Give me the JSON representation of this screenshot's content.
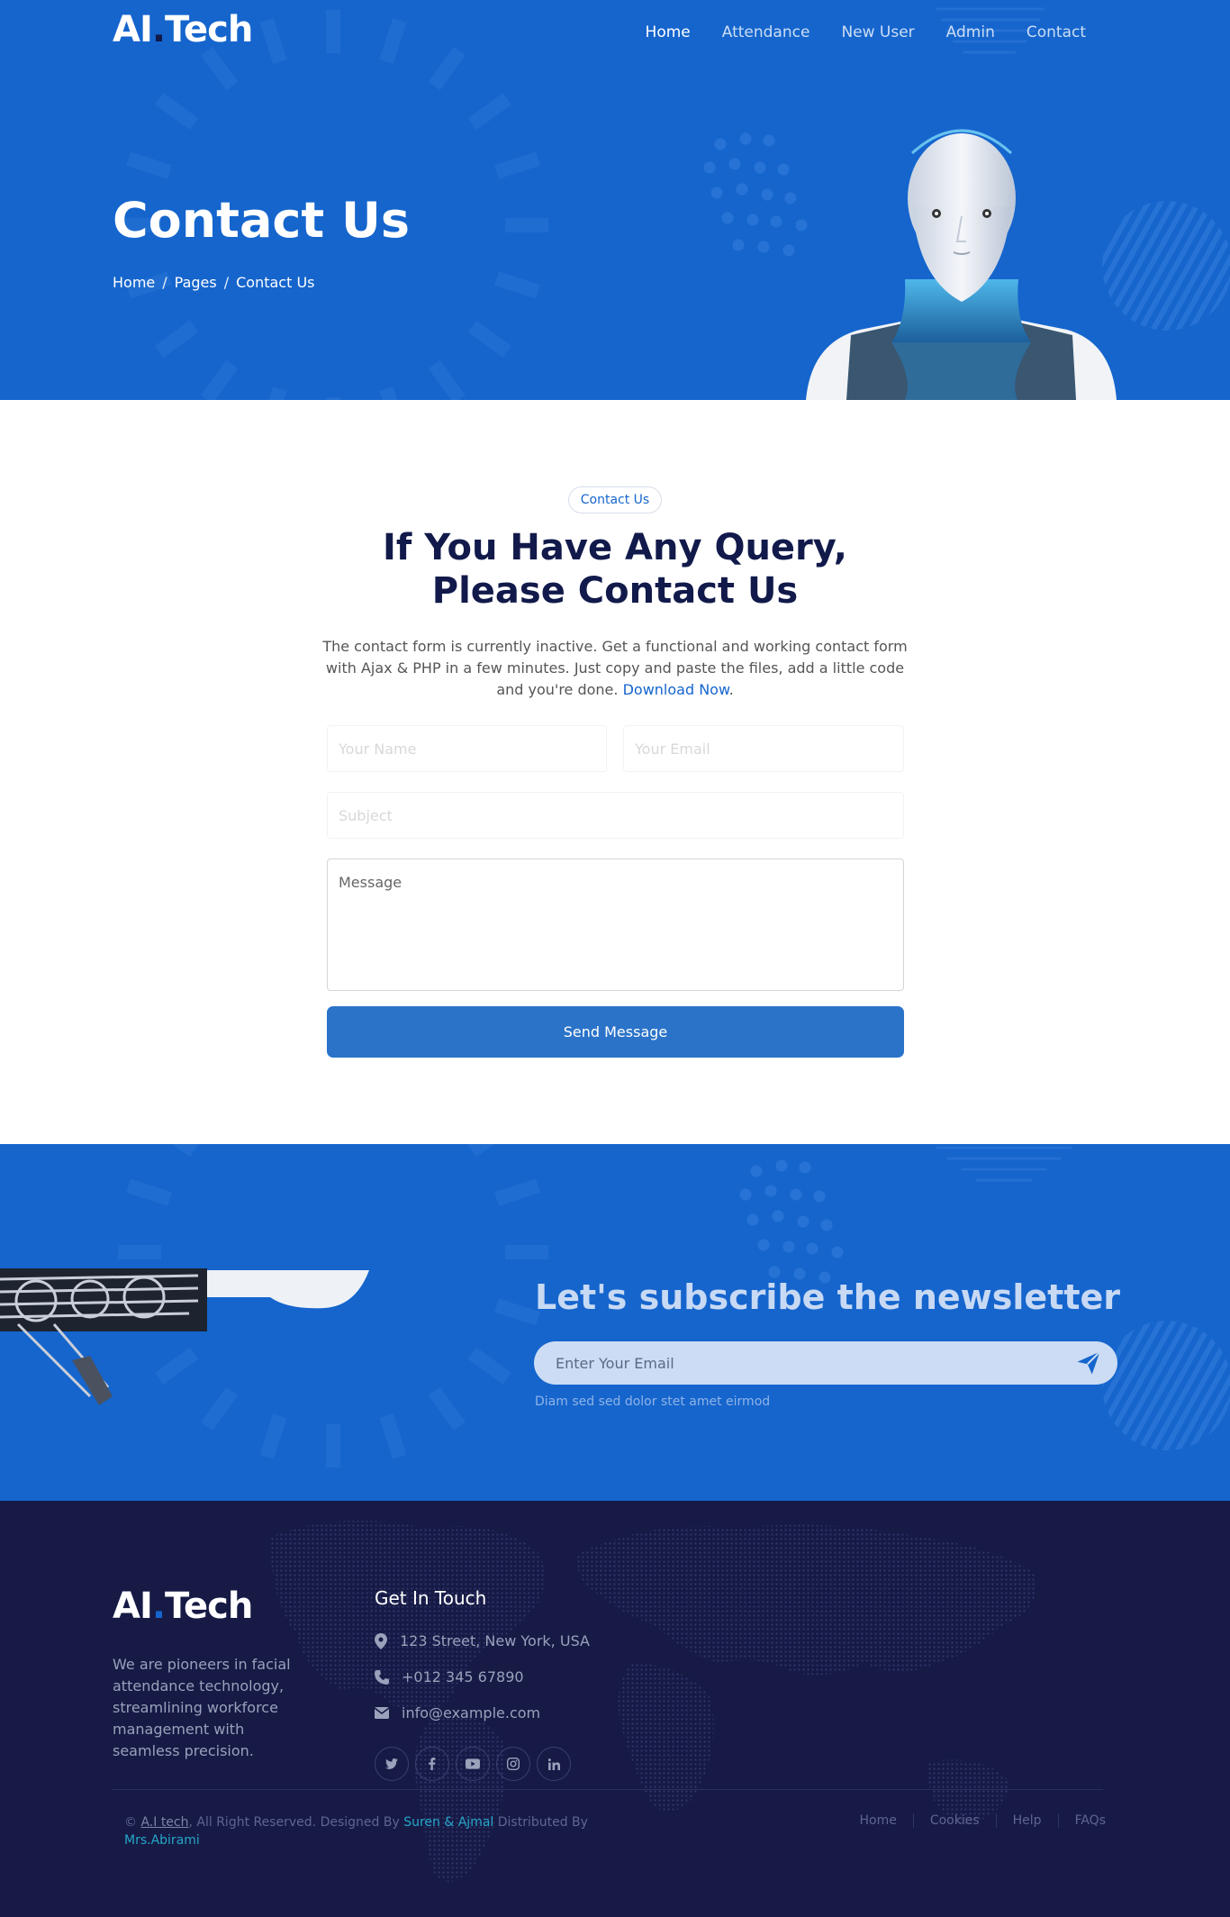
{
  "header": {
    "logo": {
      "part1": "AI",
      "dot": ".",
      "part2": "Tech"
    },
    "nav": [
      {
        "label": "Home",
        "active": true
      },
      {
        "label": "Attendance"
      },
      {
        "label": "New User"
      },
      {
        "label": "Admin"
      },
      {
        "label": "Contact"
      }
    ]
  },
  "hero": {
    "title": "Contact Us",
    "breadcrumb": [
      "Home",
      "Pages",
      "Contact Us"
    ],
    "separator": "/"
  },
  "contact": {
    "pill": "Contact Us",
    "title_line1": "If You Have Any Query,",
    "title_line2": "Please Contact Us",
    "lead": "The contact form is currently inactive. Get a functional and working contact form with Ajax & PHP in a few minutes. Just copy and paste the files, add a little code and you're done. ",
    "lead_link": "Download Now",
    "lead_end": ".",
    "form": {
      "name_placeholder": "Your Name",
      "email_placeholder": "Your Email",
      "subject_placeholder": "Subject",
      "message_placeholder": "Message",
      "send_label": "Send Message"
    }
  },
  "newsletter": {
    "title": "Let's subscribe the newsletter",
    "input_placeholder": "Enter Your Email",
    "send_icon": "paper-plane-icon",
    "note": "Diam sed sed dolor stet amet eirmod"
  },
  "footer": {
    "about": "We are pioneers in facial attendance technology, streamlining workforce management with seamless precision.",
    "heading": "Get In Touch",
    "address": "123 Street, New York, USA",
    "phone": "+012 345 67890",
    "email": "info@example.com",
    "socials": [
      "twitter-icon",
      "facebook-icon",
      "youtube-icon",
      "instagram-icon",
      "linkedin-icon"
    ],
    "copyright": {
      "prefix": "© ",
      "brand": "A.I tech",
      "mid": ", All Right Reserved. Designed By ",
      "designers": "Suren & Ajmal",
      "dist": " Distributed By ",
      "distributor": "Mrs.Abirami"
    },
    "links": [
      "Home",
      "Cookies",
      "Help",
      "FAQs"
    ]
  },
  "colors": {
    "primary": "#1565cd",
    "dark": "#161a45",
    "title": "#111a4a",
    "button": "#2a73c9"
  }
}
